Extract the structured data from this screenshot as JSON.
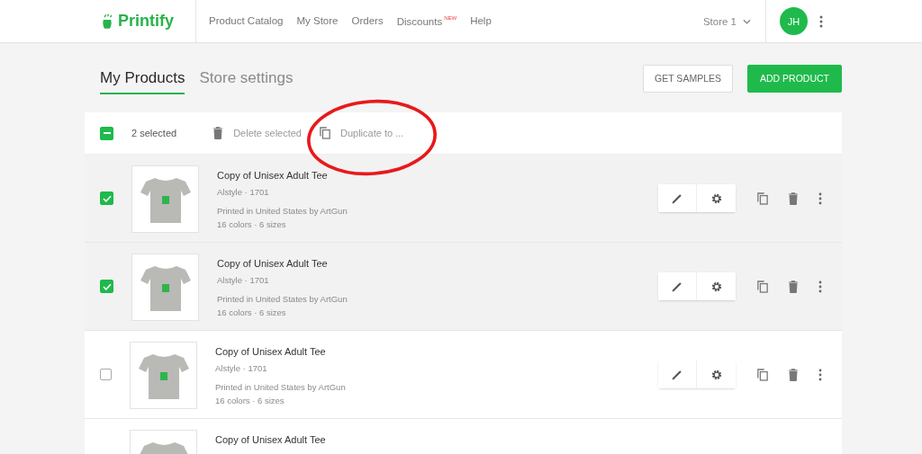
{
  "header": {
    "logo": "Printify",
    "nav": [
      {
        "label": "Product Catalog"
      },
      {
        "label": "My Store"
      },
      {
        "label": "Orders"
      },
      {
        "label": "Discounts",
        "badge": "NEW"
      },
      {
        "label": "Help"
      }
    ],
    "store": "Store 1",
    "avatar": "JH"
  },
  "tabs": [
    {
      "label": "My Products",
      "selected": true
    },
    {
      "label": "Store settings",
      "selected": false
    }
  ],
  "buttons": [
    {
      "label": "GET SAMPLES",
      "kind": "outline"
    },
    {
      "label": "ADD PRODUCT",
      "kind": "primary"
    }
  ],
  "bulk_bar": {
    "indeterminate": true,
    "count": "2 selected",
    "actions": [
      {
        "label": "Delete selected",
        "kind": "delete"
      },
      {
        "label": "Duplicate to ...",
        "kind": "duplicate"
      }
    ]
  },
  "products": [
    {
      "title": "Copy of Unisex Adult Tee",
      "brand": "Alstyle · 1701",
      "provider": "Printed in United States by ArtGun",
      "variants": "16 colors · 6 sizes",
      "checked": true
    },
    {
      "title": "Copy of Unisex Adult Tee",
      "brand": "Alstyle · 1701",
      "provider": "Printed in United States by ArtGun",
      "variants": "16 colors · 6 sizes",
      "checked": true
    },
    {
      "title": "Copy of Unisex Adult Tee",
      "brand": "Alstyle · 1701",
      "provider": "Printed in United States by ArtGun",
      "variants": "16 colors · 6 sizes",
      "checked": false
    },
    {
      "title": "Copy of Unisex Adult Tee"
    }
  ]
}
